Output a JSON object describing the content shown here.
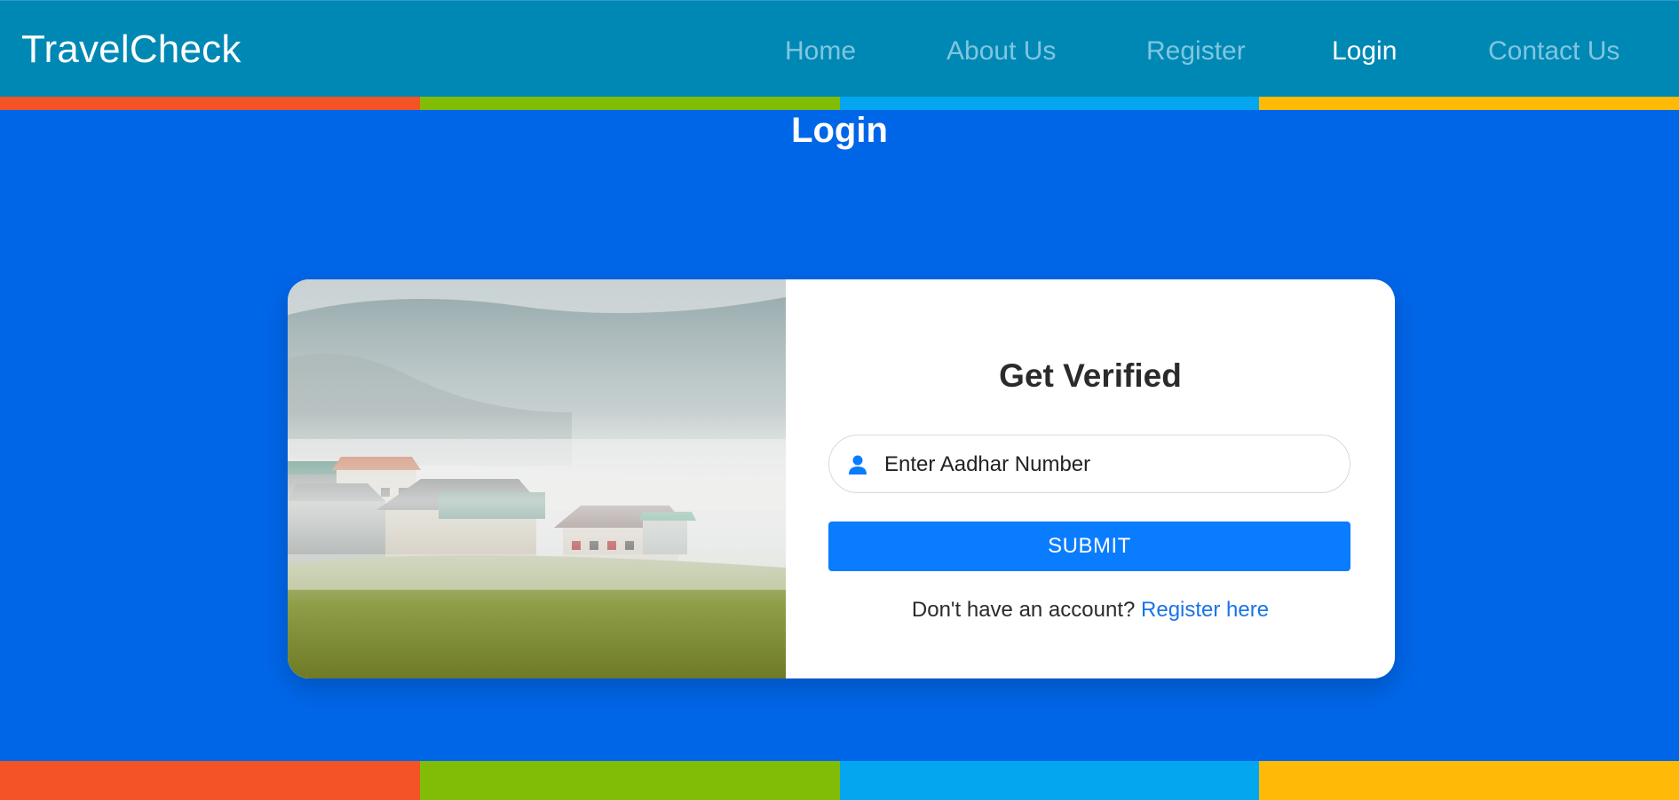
{
  "nav": {
    "brand": "TravelCheck",
    "items": [
      {
        "label": "Home",
        "active": false
      },
      {
        "label": "About Us",
        "active": false
      },
      {
        "label": "Register",
        "active": false
      },
      {
        "label": "Login",
        "active": true
      },
      {
        "label": "Contact Us",
        "active": false
      }
    ]
  },
  "page": {
    "title": "Login"
  },
  "login_card": {
    "heading": "Get Verified",
    "aadhar_input": {
      "value": "",
      "placeholder": "Enter Aadhar Number"
    },
    "submit_label": "SUBMIT",
    "register_prompt": "Don't have an account?",
    "register_link": "Register here"
  },
  "colors": {
    "navbar": "#0088b4",
    "page_background": "#0066e8",
    "button": "#0a7cff",
    "stripe": [
      "#f35325",
      "#81bc06",
      "#05a6f0",
      "#ffba08"
    ]
  },
  "icons": {
    "input_icon": "user-icon"
  }
}
